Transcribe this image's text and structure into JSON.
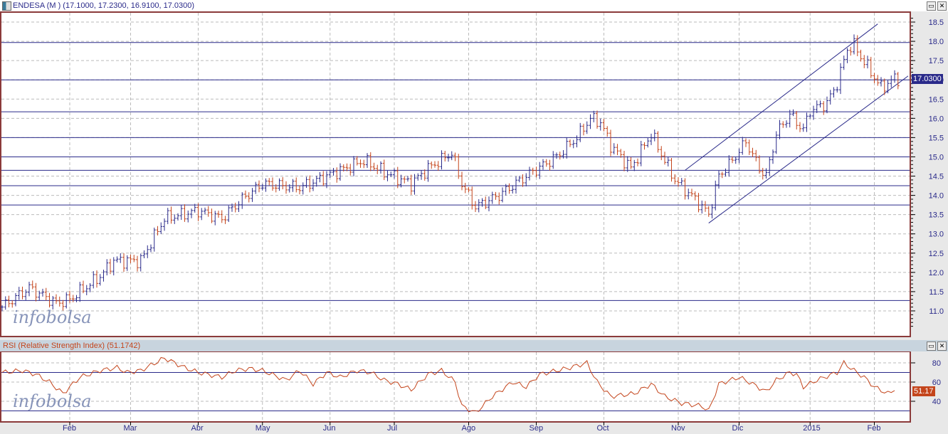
{
  "price_panel": {
    "title": "ENDESA (M ) (17.1000, 17.2300, 16.9100, 17.0300)",
    "last_badge": "17.0300",
    "watermark": "infobolsa"
  },
  "rsi_panel": {
    "title": "RSI (Relative Strength Index) (51.1742)",
    "last_badge": "51.17",
    "watermark": "infobolsa"
  },
  "buttons": {
    "minimize": "▭",
    "close": "✕"
  },
  "colors": {
    "up": "#2a2a8a",
    "down": "#c4451c",
    "line": "#2a2a8a",
    "rsi": "#c4451c",
    "border": "#8b3a3a"
  },
  "chart_data": [
    {
      "type": "ohlc",
      "title": "ENDESA (M )",
      "ylim": [
        10.5,
        18.75
      ],
      "y_ticks": [
        "18.5",
        "18.0",
        "17.5",
        "17.0",
        "16.5",
        "16.0",
        "15.5",
        "15.0",
        "14.5",
        "14.0",
        "13.5",
        "13.0",
        "12.5",
        "12.0",
        "11.5",
        "11.0"
      ],
      "x_ticks": [
        {
          "label": "Feb",
          "day": 20
        },
        {
          "label": "Mar",
          "day": 38
        },
        {
          "label": "Abr",
          "day": 58
        },
        {
          "label": "May",
          "day": 77
        },
        {
          "label": "Jun",
          "day": 97
        },
        {
          "label": "Jul",
          "day": 116
        },
        {
          "label": "Ago",
          "day": 138
        },
        {
          "label": "Sep",
          "day": 158
        },
        {
          "label": "Oct",
          "day": 178
        },
        {
          "label": "Nov",
          "day": 200
        },
        {
          "label": "Dic",
          "day": 218
        },
        {
          "label": "2015",
          "day": 239
        },
        {
          "label": "Feb",
          "day": 258
        }
      ],
      "days": 266,
      "close_anchors": [
        [
          0,
          11.1
        ],
        [
          8,
          11.6
        ],
        [
          16,
          11.2
        ],
        [
          20,
          11.3
        ],
        [
          29,
          11.9
        ],
        [
          33,
          12.3
        ],
        [
          41,
          12.3
        ],
        [
          48,
          13.4
        ],
        [
          58,
          13.6
        ],
        [
          65,
          13.4
        ],
        [
          71,
          13.9
        ],
        [
          77,
          14.3
        ],
        [
          88,
          14.2
        ],
        [
          96,
          14.5
        ],
        [
          107,
          14.9
        ],
        [
          113,
          14.6
        ],
        [
          121,
          14.3
        ],
        [
          126,
          14.7
        ],
        [
          133,
          15.1
        ],
        [
          136,
          14.3
        ],
        [
          140,
          13.7
        ],
        [
          147,
          14.0
        ],
        [
          155,
          14.5
        ],
        [
          164,
          15.0
        ],
        [
          170,
          15.5
        ],
        [
          174,
          16.0
        ],
        [
          177,
          15.9
        ],
        [
          180,
          15.3
        ],
        [
          186,
          14.7
        ],
        [
          192,
          15.6
        ],
        [
          196,
          14.9
        ],
        [
          199,
          14.4
        ],
        [
          205,
          13.9
        ],
        [
          209,
          13.5
        ],
        [
          212,
          14.5
        ],
        [
          216,
          14.9
        ],
        [
          220,
          15.4
        ],
        [
          224,
          14.7
        ],
        [
          226,
          14.5
        ],
        [
          229,
          15.6
        ],
        [
          233,
          16.1
        ],
        [
          237,
          15.7
        ],
        [
          239,
          16.2
        ],
        [
          244,
          16.4
        ],
        [
          247,
          16.9
        ],
        [
          250,
          17.8
        ],
        [
          252,
          17.9
        ],
        [
          254,
          17.6
        ],
        [
          257,
          17.2
        ],
        [
          260,
          16.8
        ],
        [
          264,
          17.03
        ]
      ],
      "horizontal_levels": [
        17.97,
        17.0,
        16.17,
        15.5,
        15.0,
        14.65,
        14.25,
        13.75,
        11.27
      ],
      "channel": {
        "upper": [
          [
            202,
            14.65
          ],
          [
            259,
            18.45
          ]
        ],
        "lower": [
          [
            209,
            13.28
          ],
          [
            268,
            17.1
          ]
        ]
      }
    },
    {
      "type": "line",
      "title": "RSI (Relative Strength Index)",
      "ylim": [
        25,
        91
      ],
      "y_ticks": [
        "80",
        "60",
        "40"
      ],
      "levels": [
        70,
        30
      ],
      "anchors": [
        [
          0,
          70
        ],
        [
          6,
          72
        ],
        [
          10,
          68
        ],
        [
          14,
          60
        ],
        [
          18,
          48
        ],
        [
          23,
          65
        ],
        [
          29,
          72
        ],
        [
          34,
          75
        ],
        [
          37,
          70
        ],
        [
          41,
          72
        ],
        [
          48,
          85
        ],
        [
          54,
          75
        ],
        [
          58,
          70
        ],
        [
          65,
          65
        ],
        [
          69,
          72
        ],
        [
          73,
          74
        ],
        [
          77,
          72
        ],
        [
          84,
          62
        ],
        [
          88,
          72
        ],
        [
          92,
          58
        ],
        [
          96,
          70
        ],
        [
          100,
          65
        ],
        [
          105,
          72
        ],
        [
          109,
          70
        ],
        [
          113,
          62
        ],
        [
          117,
          58
        ],
        [
          121,
          52
        ],
        [
          126,
          68
        ],
        [
          130,
          72
        ],
        [
          134,
          60
        ],
        [
          136,
          35
        ],
        [
          140,
          28
        ],
        [
          145,
          45
        ],
        [
          151,
          60
        ],
        [
          155,
          55
        ],
        [
          159,
          68
        ],
        [
          168,
          75
        ],
        [
          173,
          80
        ],
        [
          176,
          60
        ],
        [
          180,
          45
        ],
        [
          187,
          48
        ],
        [
          192,
          58
        ],
        [
          196,
          45
        ],
        [
          201,
          38
        ],
        [
          207,
          35
        ],
        [
          209,
          30
        ],
        [
          212,
          58
        ],
        [
          218,
          65
        ],
        [
          221,
          60
        ],
        [
          226,
          50
        ],
        [
          229,
          62
        ],
        [
          233,
          70
        ],
        [
          235,
          68
        ],
        [
          237,
          55
        ],
        [
          241,
          62
        ],
        [
          247,
          70
        ],
        [
          249,
          80
        ],
        [
          252,
          72
        ],
        [
          255,
          65
        ],
        [
          258,
          55
        ],
        [
          262,
          48
        ],
        [
          264,
          51.17
        ]
      ]
    }
  ]
}
